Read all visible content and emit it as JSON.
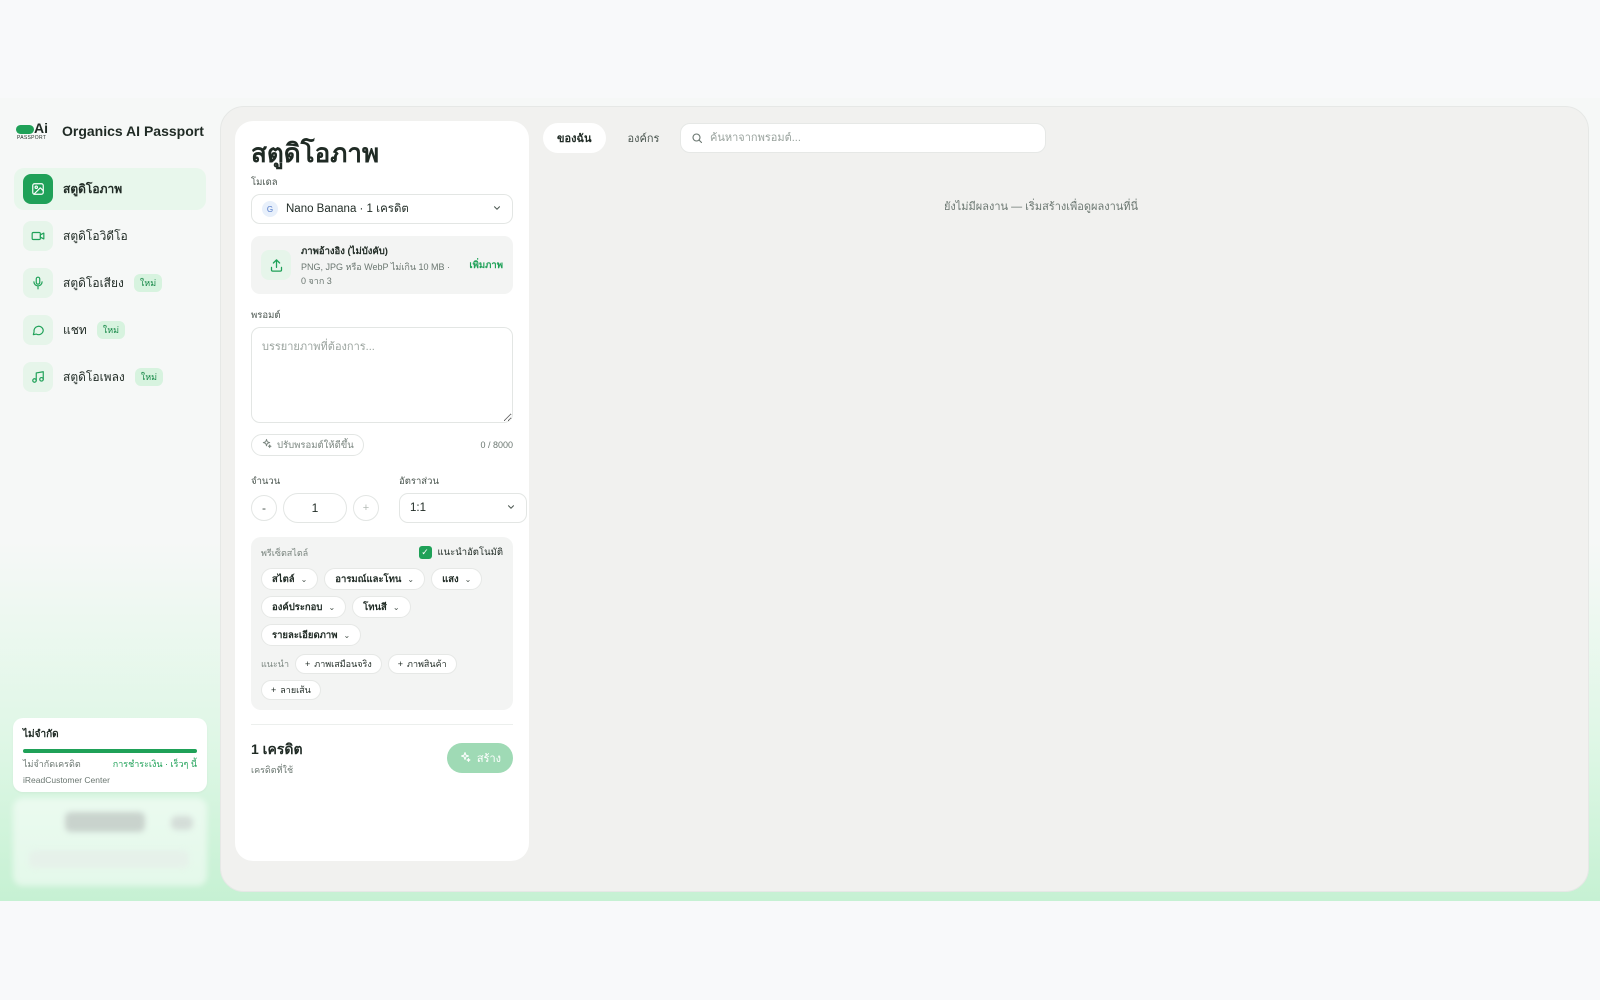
{
  "brand": {
    "logo_text": "Ai",
    "logo_sub": "PASSPORT",
    "name": "Organics AI Passport"
  },
  "nav": [
    {
      "label": "สตูดิโอภาพ",
      "icon": "image-icon",
      "active": true,
      "badge": ""
    },
    {
      "label": "สตูดิโอวิดีโอ",
      "icon": "video-icon",
      "active": false,
      "badge": ""
    },
    {
      "label": "สตูดิโอเสียง",
      "icon": "mic-icon",
      "active": false,
      "badge": "ใหม่"
    },
    {
      "label": "แชท",
      "icon": "chat-icon",
      "active": false,
      "badge": "ใหม่"
    },
    {
      "label": "สตูดิโอเพลง",
      "icon": "music-icon",
      "active": false,
      "badge": "ใหม่"
    }
  ],
  "plan": {
    "title": "ไม่จำกัด",
    "progress": 1.0,
    "left": "ไม่จำกัดเครดิต",
    "right": "การชำระเงิน · เร็วๆ นี้",
    "footer": "iReadCustomer Center"
  },
  "panel": {
    "title": "สตูดิโอภาพ",
    "model_label": "โมเดล",
    "model_value": "Nano Banana · 1 เครดิต",
    "upload": {
      "title": "ภาพอ้างอิง (ไม่บังคับ)",
      "sub1": "PNG, JPG หรือ WebP ไม่เกิน 10 MB ·",
      "sub2": "0 จาก 3",
      "add": "เพิ่มภาพ"
    },
    "prompt_label": "พรอมต์",
    "prompt_value": "",
    "prompt_placeholder": "บรรยายภาพที่ต้องการ...",
    "enhance": "ปรับพรอมต์ให้ดีขึ้น",
    "char_count": "0 / 8000",
    "qty_label": "จำนวน",
    "qty_minus": "-",
    "qty_value": "1",
    "qty_plus": "+",
    "ratio_label": "อัตราส่วน",
    "ratio_value": "1:1",
    "presets": {
      "title": "พรีเซ็ตสไตล์",
      "auto_label": "แนะนำอัตโนมัติ",
      "auto_checked": true,
      "chips": [
        "สไตล์",
        "อารมณ์และโทน",
        "แสง",
        "องค์ประกอบ",
        "โทนสี",
        "รายละเอียดภาพ"
      ],
      "suggest_label": "แนะนำ",
      "suggestions": [
        "ภาพเสมือนจริง",
        "ภาพสินค้า",
        "ลายเส้น"
      ]
    },
    "credits_value": "1 เครดิต",
    "credits_sub": "เครดิตที่ใช้",
    "create": "สร้าง"
  },
  "results": {
    "tabs": [
      {
        "label": "ของฉัน",
        "active": true
      },
      {
        "label": "องค์กร",
        "active": false
      }
    ],
    "search_placeholder": "ค้นหาจากพรอมต์...",
    "empty": "ยังไม่มีผลงาน — เริ่มสร้างเพื่อดูผลงานที่นี่"
  },
  "colors": {
    "accent": "#1fa158",
    "accent_light": "#e8f7ec",
    "create_disabled": "#9fdab5"
  }
}
